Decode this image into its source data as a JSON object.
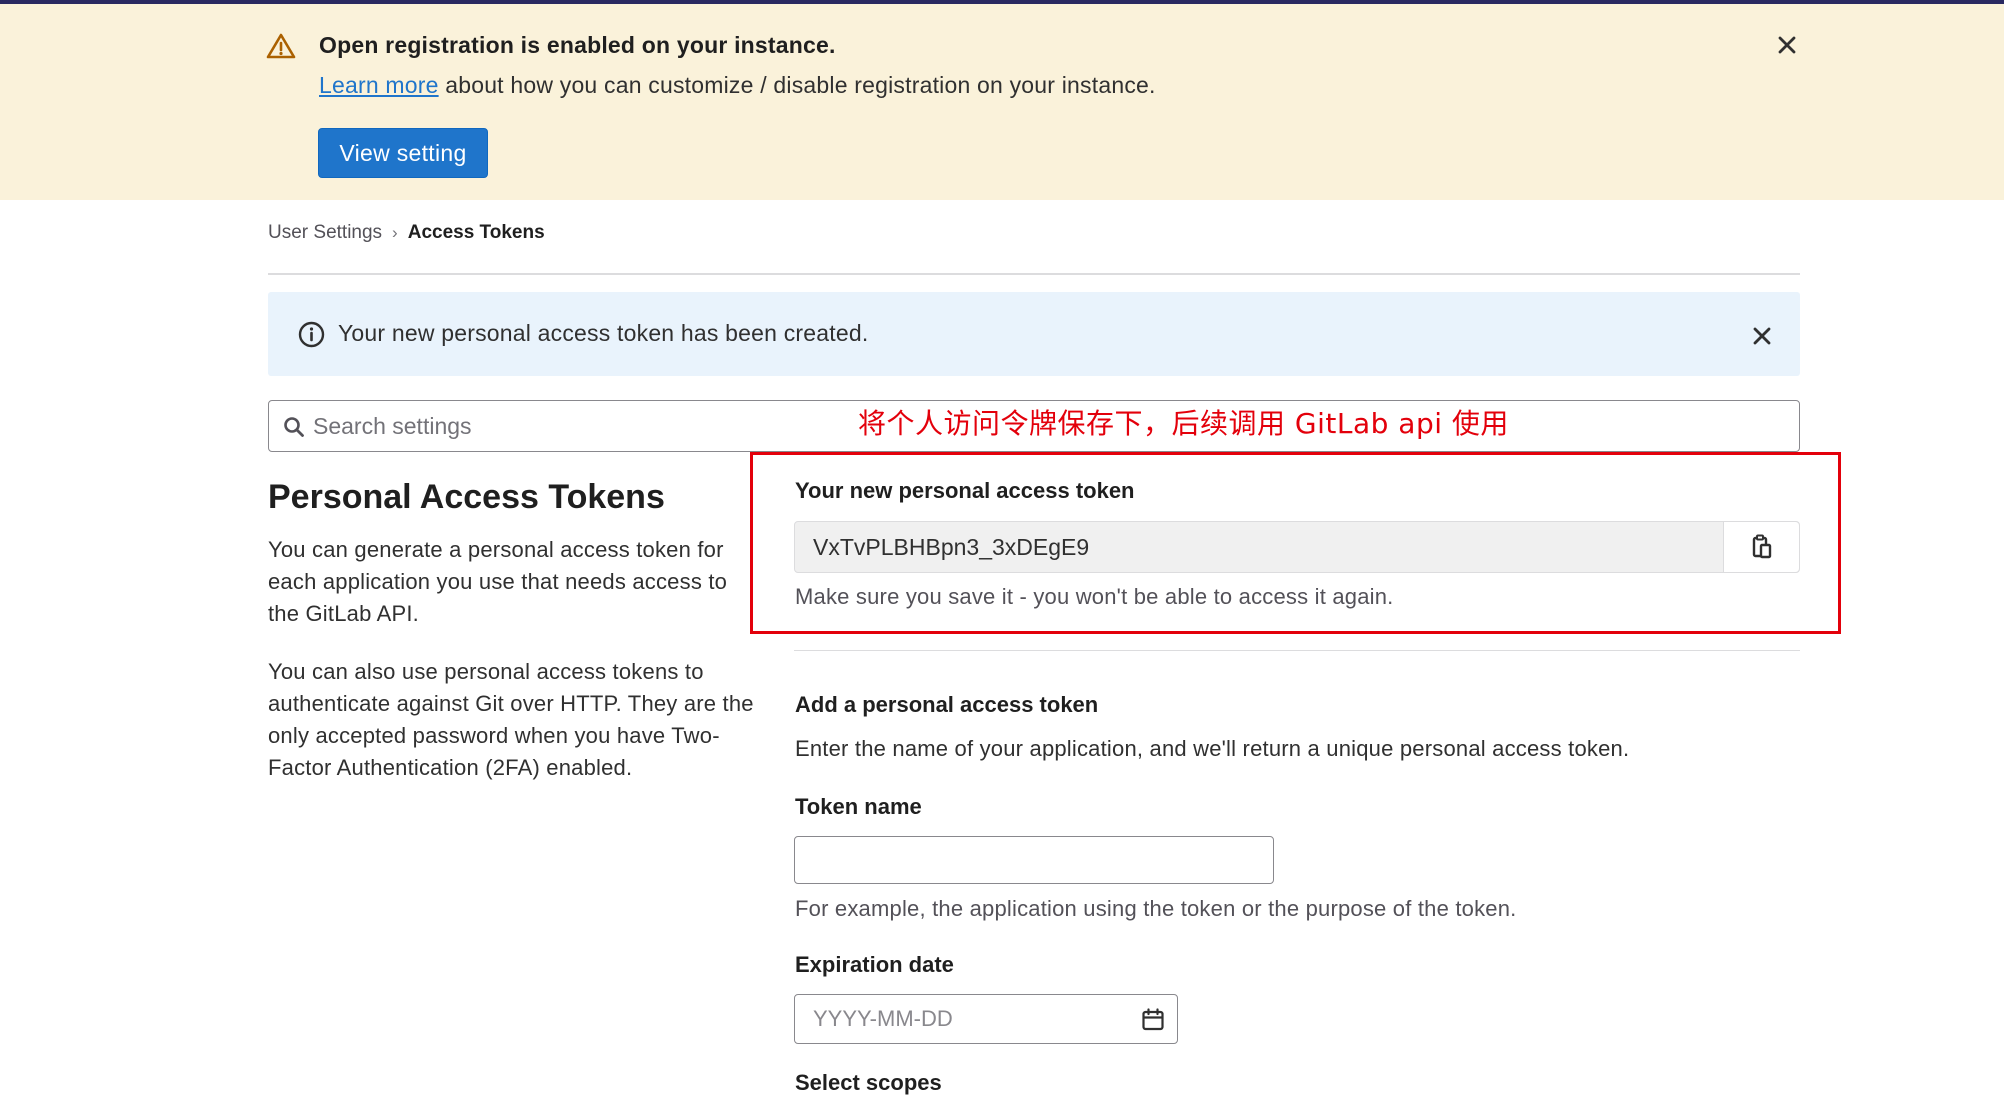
{
  "colors": {
    "banner_bg": "#faf2da",
    "primary": "#1f75cb",
    "info_bg": "#e9f3fc",
    "annotation_red": "#e3000b",
    "warning_icon": "#ab6100"
  },
  "registration_banner": {
    "title": "Open registration is enabled on your instance.",
    "learn_more": "Learn more",
    "description": " about how you can customize / disable registration on your instance.",
    "button_label": "View setting",
    "icon": "warning-icon"
  },
  "breadcrumb": {
    "items": [
      "User Settings"
    ],
    "current": "Access Tokens",
    "separator": "›"
  },
  "info_alert": {
    "message": "Your new personal access token has been created.",
    "icon": "info-circle-icon"
  },
  "search": {
    "placeholder": "Search settings"
  },
  "annotation": {
    "text": "将个人访问令牌保存下，后续调用 GitLab api 使用"
  },
  "sidebar": {
    "title": "Personal Access Tokens",
    "desc1": "You can generate a personal access token for each application you use that needs access to the GitLab API.",
    "desc2": "You can also use personal access tokens to authenticate against Git over HTTP. They are the only accepted password when you have Two-Factor Authentication (2FA) enabled."
  },
  "new_token": {
    "label": "Your new personal access token",
    "value": "VxTvPLBHBpn3_3xDEgE9",
    "help": "Make sure you save it - you won't be able to access it again.",
    "copy_icon": "clipboard-icon"
  },
  "add_token": {
    "title": "Add a personal access token",
    "description": "Enter the name of your application, and we'll return a unique personal access token.",
    "token_name_label": "Token name",
    "token_name_value": "",
    "token_name_help": "For example, the application using the token or the purpose of the token.",
    "expiration_label": "Expiration date",
    "expiration_placeholder": "YYYY-MM-DD",
    "scopes_label": "Select scopes"
  }
}
